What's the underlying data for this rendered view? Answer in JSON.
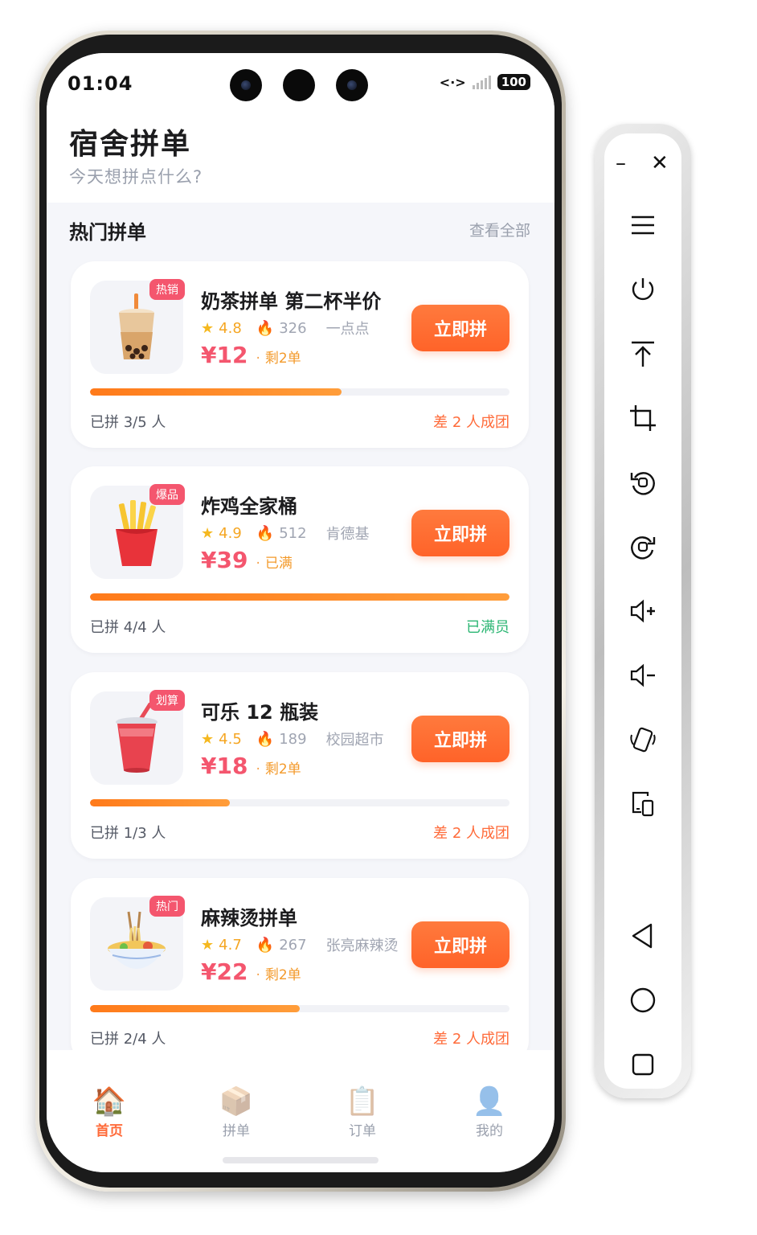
{
  "status_bar": {
    "time": "01:04",
    "battery": "100"
  },
  "header": {
    "title": "宿舍拼单",
    "subtitle": "今天想拼点什么?"
  },
  "section": {
    "title": "热门拼单",
    "view_all": "查看全部"
  },
  "cards": [
    {
      "tag": "热销",
      "name": "奶茶拼单 第二杯半价",
      "rating": "4.8",
      "sales": "326",
      "shop": "一点点",
      "price": "¥12",
      "remain": "剩2单",
      "button": "立即拼",
      "joined": "已拼 3/5 人",
      "note": "差 2 人成团",
      "progress": 0.6,
      "icon": "bubble-tea-icon"
    },
    {
      "tag": "爆品",
      "name": "炸鸡全家桶",
      "rating": "4.9",
      "sales": "512",
      "shop": "肯德基",
      "price": "¥39",
      "remain": "已满",
      "button": "立即拼",
      "joined": "已拼 4/4 人",
      "note": "已满员",
      "progress": 1.0,
      "icon": "fries-icon"
    },
    {
      "tag": "划算",
      "name": "可乐 12 瓶装",
      "rating": "4.5",
      "sales": "189",
      "shop": "校园超市",
      "price": "¥18",
      "remain": "剩2单",
      "button": "立即拼",
      "joined": "已拼 1/3 人",
      "note": "差 2 人成团",
      "progress": 0.333,
      "icon": "cola-cup-icon"
    },
    {
      "tag": "热门",
      "name": "麻辣烫拼单",
      "rating": "4.7",
      "sales": "267",
      "shop": "张亮麻辣烫",
      "price": "¥22",
      "remain": "剩2单",
      "button": "立即拼",
      "joined": "已拼 2/4 人",
      "note": "差 2 人成团",
      "progress": 0.5,
      "icon": "noodle-bowl-icon"
    }
  ],
  "bottom_nav": [
    {
      "label": "首页",
      "icon": "house-icon",
      "active": true
    },
    {
      "label": "拼单",
      "icon": "package-icon",
      "active": false
    },
    {
      "label": "订单",
      "icon": "clipboard-icon",
      "active": false
    },
    {
      "label": "我的",
      "icon": "user-icon",
      "active": false
    }
  ],
  "colors": {
    "accent": "#ff6b3a",
    "price": "#f4566e",
    "full": "#2bb673"
  }
}
